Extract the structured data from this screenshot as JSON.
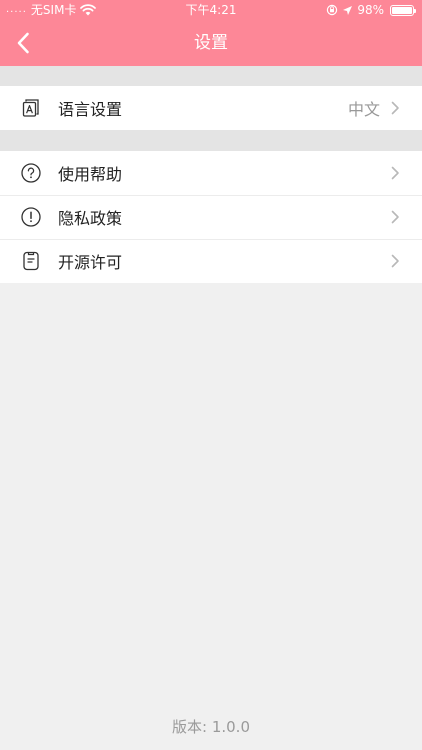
{
  "status_bar": {
    "signal": ".....",
    "carrier": "无SIM卡",
    "time": "下午4:21",
    "battery": "98%",
    "battery_level": 0.98
  },
  "nav": {
    "title": "设置",
    "back_icon": "chevron-left-icon"
  },
  "groups": [
    {
      "rows": [
        {
          "icon": "language-icon",
          "label": "语言设置",
          "value": "中文"
        }
      ]
    },
    {
      "rows": [
        {
          "icon": "help-icon",
          "label": "使用帮助"
        },
        {
          "icon": "privacy-icon",
          "label": "隐私政策"
        },
        {
          "icon": "license-icon",
          "label": "开源许可"
        }
      ]
    }
  ],
  "footer": {
    "version": "版本: 1.0.0"
  },
  "colors": {
    "header": "#fd8797",
    "background": "#f0f0f0",
    "band": "#e4e4e4"
  }
}
